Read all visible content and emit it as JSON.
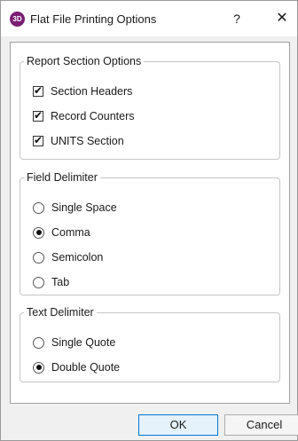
{
  "window": {
    "app_icon_text": "3D",
    "title": "Flat File Printing Options",
    "help_glyph": "?",
    "close_glyph": "✕"
  },
  "report_section": {
    "legend": "Report Section Options",
    "options": [
      {
        "label": "Section Headers",
        "checked": true
      },
      {
        "label": "Record Counters",
        "checked": true
      },
      {
        "label": "UNITS Section",
        "checked": true
      }
    ]
  },
  "field_delimiter": {
    "legend": "Field Delimiter",
    "options": [
      {
        "label": "Single Space",
        "selected": false
      },
      {
        "label": "Comma",
        "selected": true
      },
      {
        "label": "Semicolon",
        "selected": false
      },
      {
        "label": "Tab",
        "selected": false
      }
    ]
  },
  "text_delimiter": {
    "legend": "Text Delimiter",
    "options": [
      {
        "label": "Single Quote",
        "selected": false
      },
      {
        "label": "Double Quote",
        "selected": true
      }
    ]
  },
  "buttons": {
    "ok": "OK",
    "cancel": "Cancel"
  }
}
